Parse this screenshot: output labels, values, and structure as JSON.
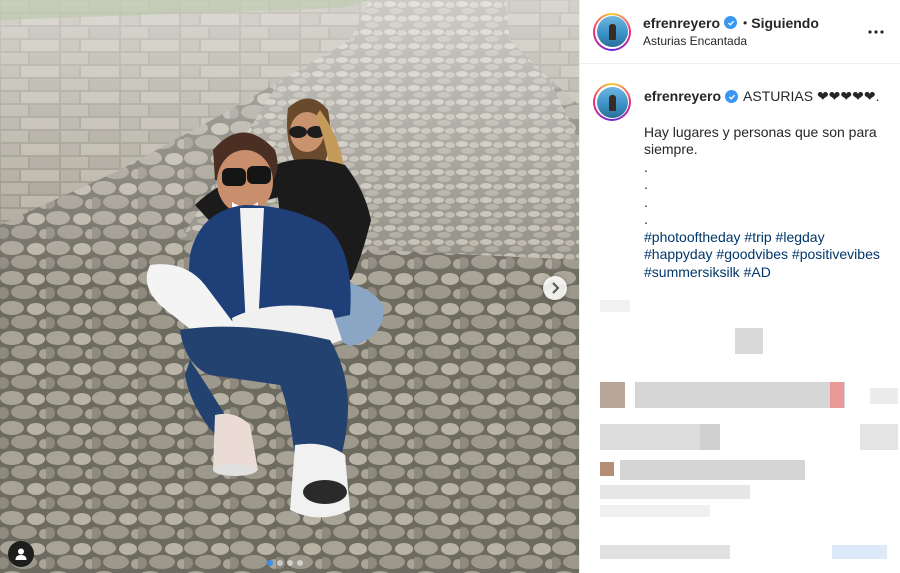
{
  "post": {
    "username": "efrenreyero",
    "follow_separator": "•",
    "follow_status": "Siguiendo",
    "location": "Asturias Encantada",
    "caption_title": "ASTURIAS ❤❤❤❤❤.",
    "caption_line1": "Hay lugares y personas que son para siempre.",
    "caption_dots": [
      ".",
      ".",
      ".",
      "."
    ],
    "hashtags_line1": [
      "#photooftheday",
      "#trip",
      "#legday"
    ],
    "hashtags_line2": [
      "#happyday",
      "#goodvibes",
      "#positivevibes"
    ],
    "hashtags_line3": [
      "#summersiksilk",
      "#AD"
    ]
  },
  "icons": {
    "verified": "verified-badge-icon",
    "more": "more-options-icon",
    "next": "chevron-right-icon",
    "tag": "user-tag-icon"
  },
  "colors": {
    "link": "#00376b",
    "verified": "#3897f0",
    "carousel_active_dot": "#3a8ff0"
  }
}
